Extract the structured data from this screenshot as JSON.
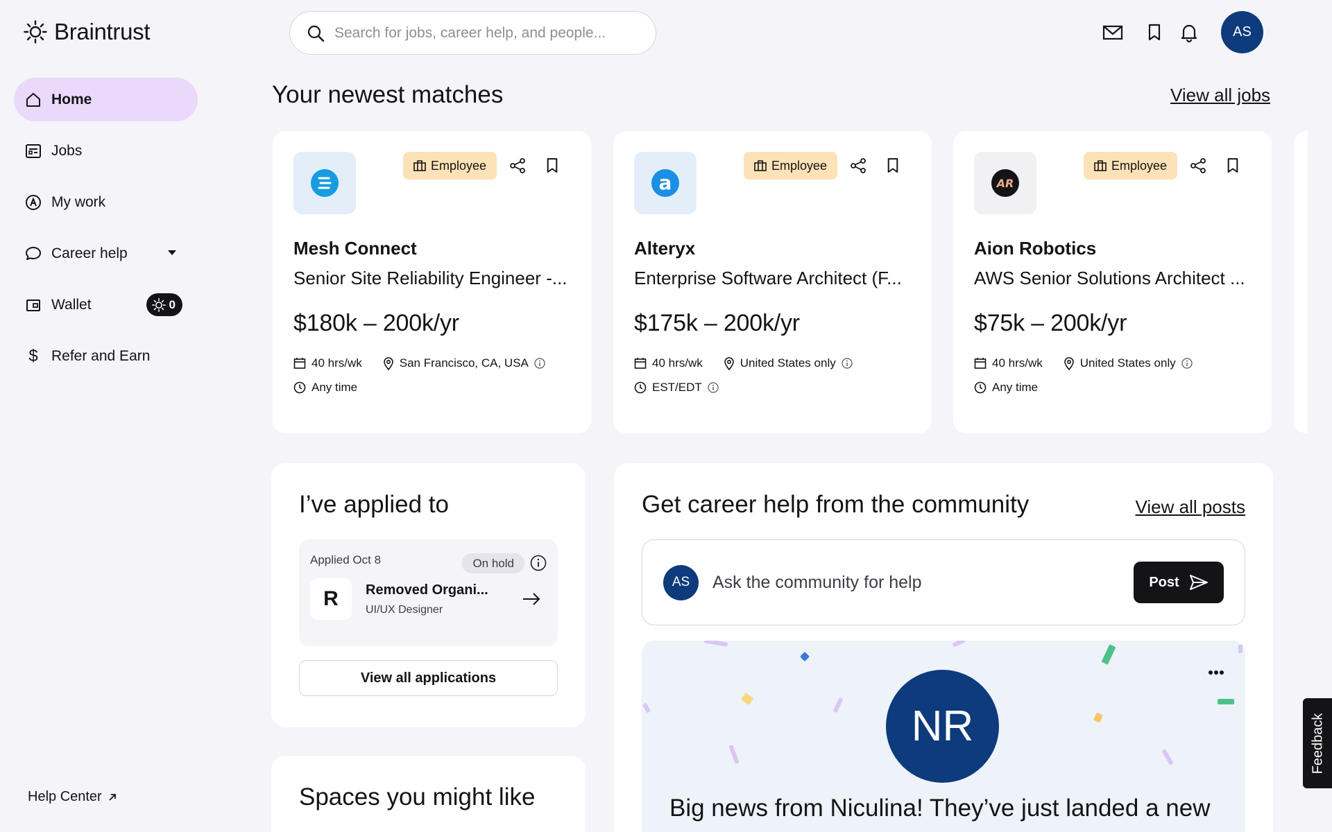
{
  "app": {
    "name": "Braintrust"
  },
  "search": {
    "placeholder": "Search for jobs, career help, and people..."
  },
  "user": {
    "initials": "AS"
  },
  "nav": {
    "items": [
      {
        "label": "Home",
        "icon": "home-icon"
      },
      {
        "label": "Jobs",
        "icon": "jobs-icon"
      },
      {
        "label": "My work",
        "icon": "my-work-icon"
      },
      {
        "label": "Career help",
        "icon": "chat-icon"
      },
      {
        "label": "Wallet",
        "icon": "wallet-icon"
      },
      {
        "label": "Refer and Earn",
        "icon": "dollar-icon"
      }
    ],
    "wallet_balance": "0",
    "help_center": "Help Center"
  },
  "matches": {
    "title": "Your newest matches",
    "view_all": "View all jobs",
    "jobs": [
      {
        "company": "Mesh Connect",
        "title": "Senior Site Reliability Engineer -...",
        "salary": "$180k – 200k/yr",
        "type": "Employee",
        "hours": "40 hrs/wk",
        "location": "San Francisco, CA, USA",
        "timezone": "Any time",
        "logo_color": "#1a8fe3"
      },
      {
        "company": "Alteryx",
        "title": "Enterprise Software Architect (F...",
        "salary": "$175k – 200k/yr",
        "type": "Employee",
        "hours": "40 hrs/wk",
        "location": "United States only",
        "timezone": "EST/EDT",
        "logo_color": "#1a8fe3"
      },
      {
        "company": "Aion Robotics",
        "title": "AWS Senior Solutions Architect ...",
        "salary": "$75k – 200k/yr",
        "type": "Employee",
        "hours": "40 hrs/wk",
        "location": "United States only",
        "timezone": "Any time",
        "logo_color": "#141417"
      }
    ]
  },
  "applied": {
    "title": "I’ve applied to",
    "date": "Applied Oct 8",
    "status": "On hold",
    "company_initial": "R",
    "company": "Removed Organi...",
    "role": "UI/UX Designer",
    "view_all": "View all applications"
  },
  "spaces": {
    "title": "Spaces you might like"
  },
  "community": {
    "title": "Get career help from the community",
    "view_all": "View all posts",
    "ask_placeholder": "Ask the community for help",
    "post_label": "Post",
    "news_initials": "NR",
    "news_text": "Big news from Niculina! They’ve just landed a new"
  },
  "feedback": {
    "label": "Feedback"
  },
  "colors": {
    "accent": "#ead9fb",
    "avatar": "#0d3b7c",
    "badge": "#fce2b6"
  }
}
